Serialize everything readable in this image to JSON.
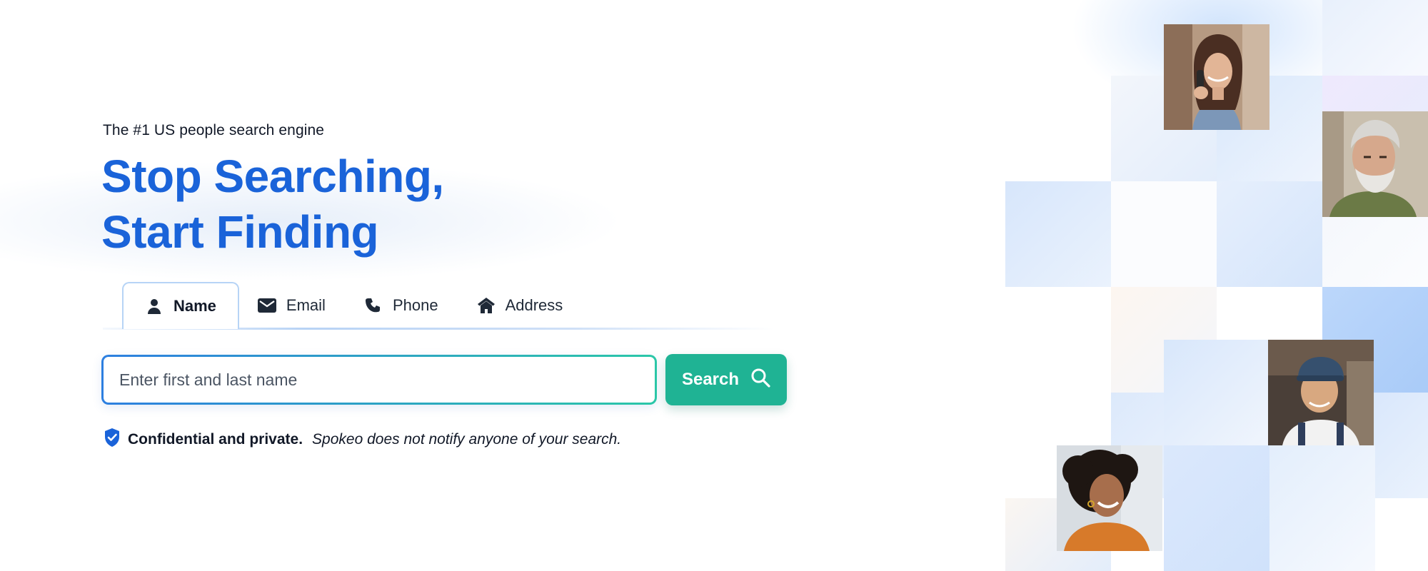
{
  "hero": {
    "eyebrow": "The #1 US people search engine",
    "headline_line1": "Stop Searching,",
    "headline_line2": "Start Finding"
  },
  "tabs": [
    {
      "label": "Name",
      "icon": "person-icon",
      "active": true
    },
    {
      "label": "Email",
      "icon": "envelope-icon",
      "active": false
    },
    {
      "label": "Phone",
      "icon": "phone-icon",
      "active": false
    },
    {
      "label": "Address",
      "icon": "house-icon",
      "active": false
    }
  ],
  "search": {
    "placeholder": "Enter first and last name",
    "value": "",
    "button_label": "Search",
    "button_icon": "magnifier-icon"
  },
  "privacy": {
    "icon": "shield-check-icon",
    "bold_text": "Confidential and private.",
    "italic_text": "Spokeo does not notify anyone of your search."
  },
  "colors": {
    "headline": "#1a63d9",
    "search_button": "#1fb394",
    "input_border_start": "#2d7fe0",
    "input_border_end": "#2bc7a8",
    "shield": "#1a63d9"
  },
  "mosaic_photos": [
    {
      "description_icon": "person-photo-woman-phone"
    },
    {
      "description_icon": "person-photo-older-man"
    },
    {
      "description_icon": "person-photo-man-cap"
    },
    {
      "description_icon": "person-photo-woman-curly-hair"
    }
  ]
}
